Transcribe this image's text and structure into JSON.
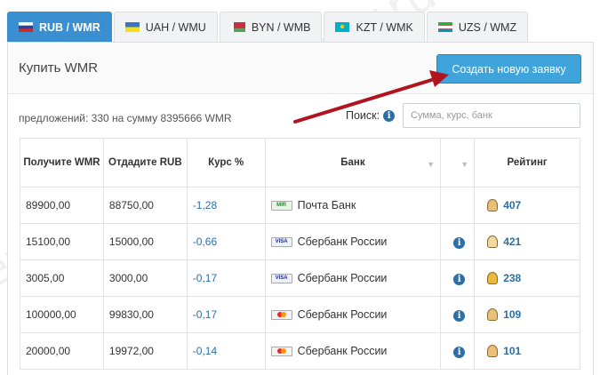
{
  "tabs": [
    {
      "label": "RUB / WMR",
      "flag": "ru"
    },
    {
      "label": "UAH / WMU",
      "flag": "ua"
    },
    {
      "label": "BYN / WMB",
      "flag": "by"
    },
    {
      "label": "KZT / WMK",
      "flag": "kz"
    },
    {
      "label": "UZS / WMZ",
      "flag": "uz"
    }
  ],
  "panel": {
    "title": "Купить WMR",
    "create_button": "Создать новую заявку",
    "summary": "предложений: 330 на сумму 8395666 WMR",
    "search_label": "Поиск:",
    "search_placeholder": "Сумма, курс, банк"
  },
  "table": {
    "headers": [
      "Получите WMR",
      "Отдадите RUB",
      "Курс %",
      "Банк",
      "",
      "Рейтинг"
    ],
    "rows": [
      {
        "receive": "89900,00",
        "give": "88750,00",
        "rate": "-1,28",
        "card": "MIR",
        "bank": "Почта Банк",
        "info": false,
        "rating": "407",
        "avatar": "man"
      },
      {
        "receive": "15100,00",
        "give": "15000,00",
        "rate": "-0,66",
        "card": "VISA",
        "bank": "Сбербанк России",
        "info": true,
        "rating": "421",
        "avatar": "woman"
      },
      {
        "receive": "3005,00",
        "give": "3000,00",
        "rate": "-0,17",
        "card": "VISA",
        "bank": "Сбербанк России",
        "info": true,
        "rating": "238",
        "avatar": "shop"
      },
      {
        "receive": "100000,00",
        "give": "99830,00",
        "rate": "-0,17",
        "card": "MC",
        "bank": "Сбербанк России",
        "info": true,
        "rating": "109",
        "avatar": "man"
      },
      {
        "receive": "20000,00",
        "give": "19972,00",
        "rate": "-0,14",
        "card": "MC",
        "bank": "Сбербанк России",
        "info": true,
        "rating": "101",
        "avatar": "man"
      }
    ]
  },
  "watermark": "ewalletpay.ru",
  "colors": {
    "accent": "#3a8fd0",
    "button": "#3fa4dc",
    "link": "#2c6fa6",
    "arrow": "#b0151f"
  }
}
